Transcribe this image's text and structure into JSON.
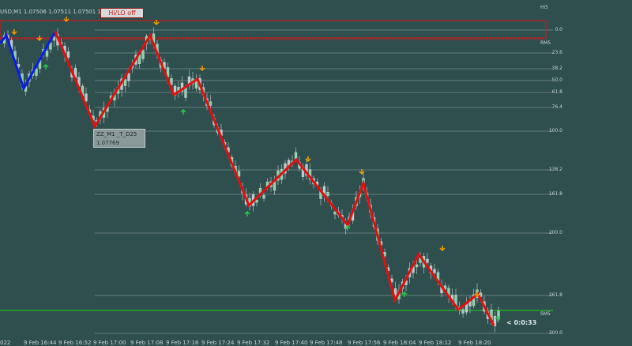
{
  "ticker": "USD,M1  1.07506 1.07511 1.07501 1.0",
  "hilo_button": "Hi/LO off",
  "tooltip": {
    "line1": "ZZ_M1 _T_D25",
    "line2": "1.07769"
  },
  "right_labels": {
    "top": "Hi5",
    "rm5": "RM5",
    "sm5": "SM5"
  },
  "fib_levels": [
    {
      "label": "0.0"
    },
    {
      "label": "23.6"
    },
    {
      "label": "38.2"
    },
    {
      "label": "50.0"
    },
    {
      "label": "61.8"
    },
    {
      "label": "76.4"
    },
    {
      "label": "100.0"
    },
    {
      "label": "138.2"
    },
    {
      "label": "161.8"
    },
    {
      "label": "200.0"
    },
    {
      "label": "261.8"
    },
    {
      "label": "300.0"
    }
  ],
  "time_axis": [
    "022",
    "9 Feb 16:44",
    "9 Feb 16:52",
    "9 Feb 17:00",
    "9 Feb 17:08",
    "9 Feb 17:16",
    "9 Feb 17:24",
    "9 Feb 17:32",
    "9 Feb 17:40",
    "9 Feb 17:48",
    "9 Feb 17:56",
    "9 Feb 18:04",
    "9 Feb 18:12",
    "9 Feb 18:20"
  ],
  "countdown": "< 0:0:33",
  "colors": {
    "background": "#2f4f4f",
    "zigzag_red": "#e01010",
    "zigzag_blue": "#0a1ee0",
    "arrow_up": "#22cc44",
    "arrow_down": "#f0a000",
    "level_line": "#9aa8a8",
    "green_line": "#22cc22"
  }
}
